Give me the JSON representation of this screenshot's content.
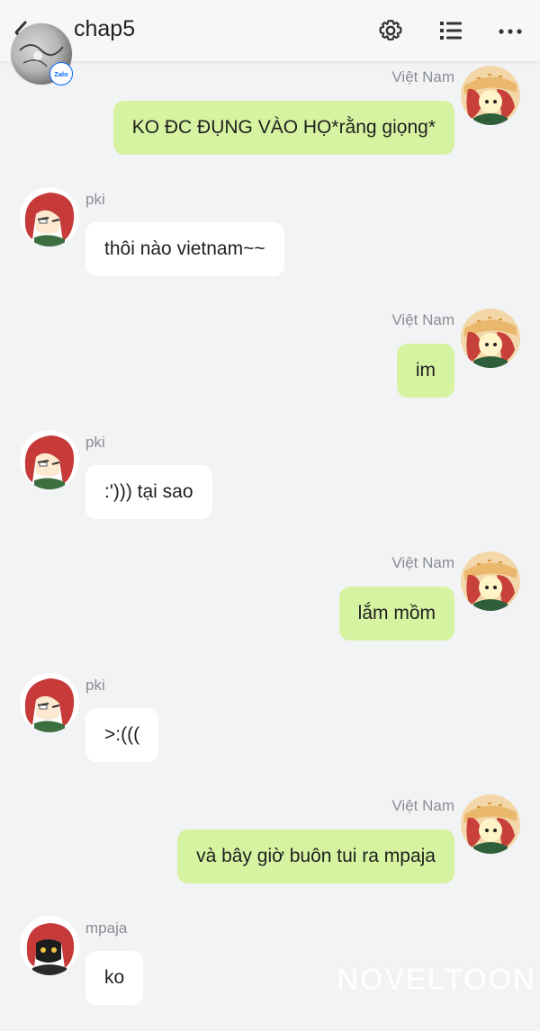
{
  "header": {
    "title": "chap5",
    "icons": [
      "back-icon",
      "settings-icon",
      "list-icon",
      "more-icon"
    ],
    "badge": "Zalo"
  },
  "messages": [
    {
      "side": "out",
      "sender": "Việt Nam",
      "text": "KO ĐC ĐỤNG VÀO HỌ*rằng giọng*"
    },
    {
      "side": "in",
      "sender": "pki",
      "text": "thôi nào vietnam~~"
    },
    {
      "side": "out",
      "sender": "Việt Nam",
      "text": "im"
    },
    {
      "side": "in",
      "sender": "pki",
      "text": ":')))  tại sao"
    },
    {
      "side": "out",
      "sender": "Việt Nam",
      "text": "lắm mồm"
    },
    {
      "side": "in",
      "sender": "pki",
      "text": ">:((("
    },
    {
      "side": "out",
      "sender": "Việt Nam",
      "text": "và bây giờ buôn tui ra mpaja"
    },
    {
      "side": "in",
      "sender": "mpaja",
      "text": "ko"
    }
  ],
  "watermark": "NOVELTOON",
  "colors": {
    "background": "#f2f3f5",
    "outgoing_bubble": "#d5f3a1",
    "incoming_bubble": "#ffffff",
    "sender_name": "#8a8d91"
  }
}
